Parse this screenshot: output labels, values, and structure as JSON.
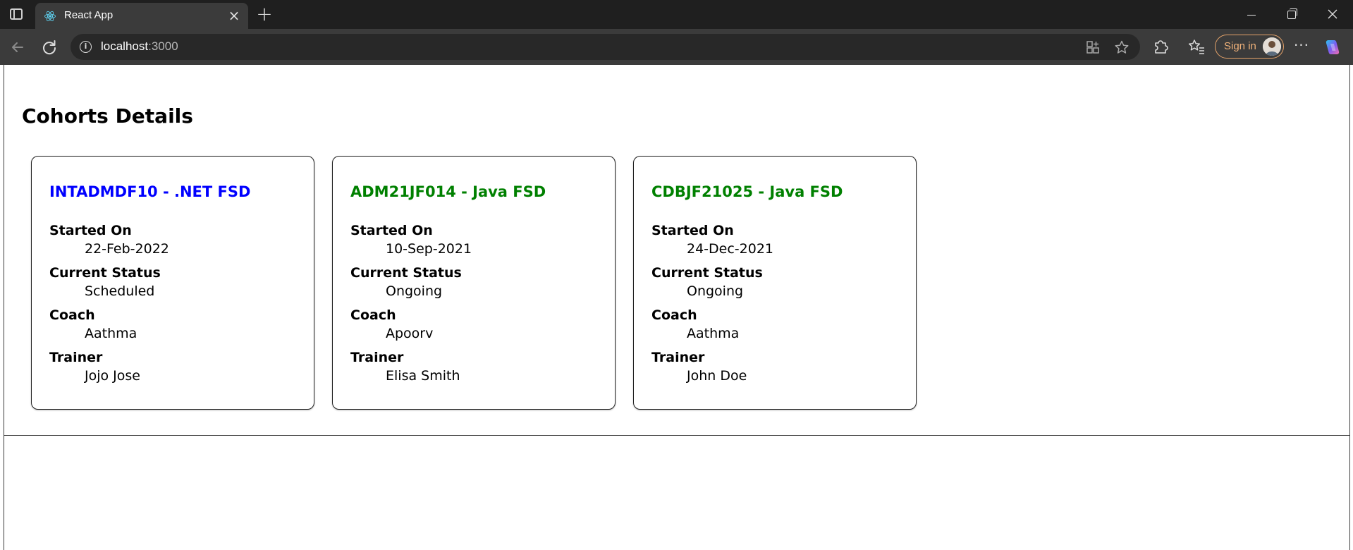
{
  "browser": {
    "tab_title": "React App",
    "tab_close_glyph": "×",
    "new_tab_glyph": "+",
    "url_host": "localhost",
    "url_port": ":3000",
    "sign_in_label": "Sign in",
    "more_glyph": "···",
    "info_glyph": "i"
  },
  "page": {
    "title": "Cohorts Details"
  },
  "colors": {
    "scheduled": "#0000ff",
    "ongoing": "#008000",
    "sign_in_accent": "#f0b27a"
  },
  "cohorts": [
    {
      "title": "INTADMDF10 - .NET FSD",
      "title_color": "#0000ff",
      "started_on_label": "Started On",
      "started_on": "22-Feb-2022",
      "status_label": "Current Status",
      "status": "Scheduled",
      "coach_label": "Coach",
      "coach": "Aathma",
      "trainer_label": "Trainer",
      "trainer": "Jojo Jose"
    },
    {
      "title": "ADM21JF014 - Java FSD",
      "title_color": "#008000",
      "started_on_label": "Started On",
      "started_on": "10-Sep-2021",
      "status_label": "Current Status",
      "status": "Ongoing",
      "coach_label": "Coach",
      "coach": "Apoorv",
      "trainer_label": "Trainer",
      "trainer": "Elisa Smith"
    },
    {
      "title": "CDBJF21025 - Java FSD",
      "title_color": "#008000",
      "started_on_label": "Started On",
      "started_on": "24-Dec-2021",
      "status_label": "Current Status",
      "status": "Ongoing",
      "coach_label": "Coach",
      "coach": "Aathma",
      "trainer_label": "Trainer",
      "trainer": "John Doe"
    }
  ]
}
